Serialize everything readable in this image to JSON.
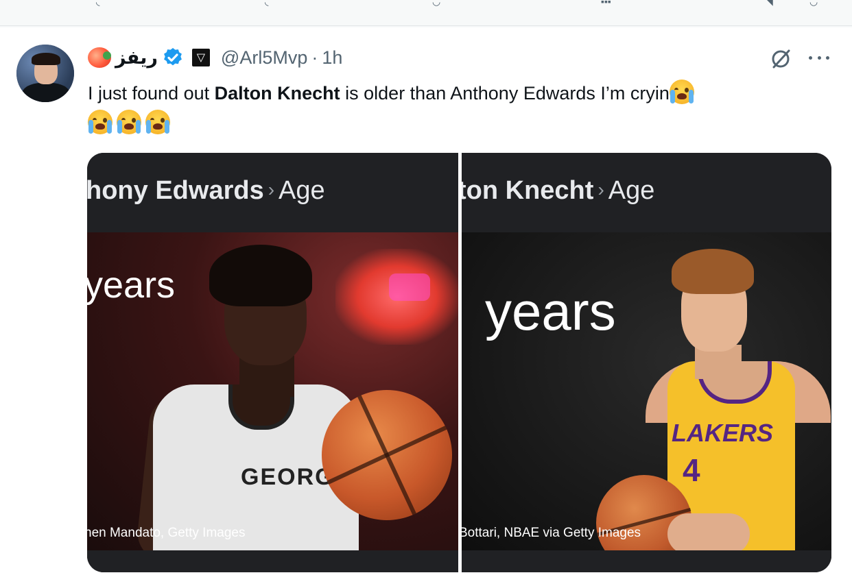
{
  "tweet": {
    "display_name": "ريفز",
    "handle": "@Arl5Mvp",
    "separator": "·",
    "time": "1h",
    "text_before": "I just found out ",
    "text_bold": "Dalton Knecht",
    "text_after": " is older than Anthony Edwards I’m cryin",
    "icons": [
      "apple-emoji",
      "verified-badge-icon",
      "affiliate-badge-icon",
      "grok-icon",
      "more-icon",
      "loudly-crying-emoji"
    ],
    "colors": {
      "verified": "#1d9bf0",
      "secondary_text": "#536471"
    }
  },
  "media": {
    "left": {
      "crumb_title": "hony Edwards",
      "crumb_sep": "›",
      "crumb_age": "Age",
      "years_text": "years",
      "credit": "hen Mandato, Getty Images",
      "jersey_text": "GEORGIA"
    },
    "right": {
      "crumb_title": "ton Knecht",
      "crumb_sep": "›",
      "crumb_age": "Age",
      "years_text": "years",
      "credit": "Bottari, NBAE via Getty Images",
      "jersey_text": "LAKERS",
      "jersey_number": "4"
    }
  }
}
